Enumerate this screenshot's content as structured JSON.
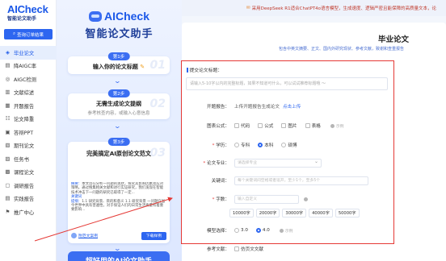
{
  "sidebar": {
    "logo_title": "AICheck",
    "logo_sub": "智能论文助手",
    "query_button": "查询订单结果",
    "items": [
      {
        "label": "毕业论文",
        "icon": "graduation-icon",
        "glyph": "◈",
        "active": true
      },
      {
        "label": "降AIGC率",
        "icon": "reduce-aigc-icon",
        "glyph": "▤",
        "active": false
      },
      {
        "label": "AIGC检测",
        "icon": "detect-icon",
        "glyph": "◎",
        "active": false
      },
      {
        "label": "文献综述",
        "icon": "literature-icon",
        "glyph": "▥",
        "active": false
      },
      {
        "label": "开题报告",
        "icon": "proposal-icon",
        "glyph": "▦",
        "active": false
      },
      {
        "label": "论文降重",
        "icon": "dedup-icon",
        "glyph": "☷",
        "active": false
      },
      {
        "label": "答辩PPT",
        "icon": "ppt-icon",
        "glyph": "▣",
        "active": false
      },
      {
        "label": "期刊论文",
        "icon": "journal-icon",
        "glyph": "▧",
        "active": false
      },
      {
        "label": "任务书",
        "icon": "task-icon",
        "glyph": "▨",
        "active": false
      },
      {
        "label": "课程论文",
        "icon": "course-icon",
        "glyph": "▩",
        "active": false
      },
      {
        "label": "调研报告",
        "icon": "survey-icon",
        "glyph": "▢",
        "active": false
      },
      {
        "label": "实践报告",
        "icon": "practice-icon",
        "glyph": "▤",
        "active": false
      },
      {
        "label": "推广中心",
        "icon": "promo-icon",
        "glyph": "⚑",
        "active": false
      }
    ]
  },
  "promo": {
    "brand": "AICheck",
    "title": "智能论文助手",
    "step1": {
      "badge": "第1步",
      "title": "输入你的论文标题",
      "num": "01"
    },
    "step2": {
      "badge": "第2步",
      "title": "无需生成论文提纲",
      "sub": "参考核查内容，或输入心意信息",
      "num": "02"
    },
    "step3": {
      "badge": "第3步",
      "title": "完美搞定AI原创论文范文",
      "num": "03",
      "abstract_label": "摘要：",
      "abstract": "本文旨在分析一问题的现状，探究其影响因素及应对策略。通过搜集相关文献和进行实证研究，我们发现在智能技术冲击下一问题的研究已取得了一定...",
      "keywords_label": "关键词",
      "outline_label": "提纲：",
      "outline": "1.1 研究背景、目的和意义 1.1 研究背景 一问题在当今世界中具有普遍性，对于保证人们的日常生活质量有着重要影响...",
      "author": "附范文案例",
      "download": "下载样例"
    },
    "bottom": "超好用的AI论文助手"
  },
  "main": {
    "marquee": "采用DeepSeek R1适合ChatPT4o语言模型，生成速度、逻辑严密且能保障的高质量文本，论",
    "form_title": "毕业论文",
    "form_sub": "包含中英文摘要、正文、国内外研究现状、参考文献，致谢和查重报告",
    "topic_label": "提交论文标题：",
    "topic_placeholder": "请输入5-10字以内的完整标题，如果不知道可什么，可以试试推荐标题哦 ～",
    "report_label": "开题报告：",
    "report_text": "上传开题报告生成论文",
    "report_link": "点击上传",
    "chart_label": "图表公式：",
    "chart_options": [
      "代码",
      "公式",
      "图片",
      "表格"
    ],
    "chart_hint": "示例",
    "degree_label": "学历：",
    "degree_options": [
      {
        "label": "专科",
        "on": false
      },
      {
        "label": "本科",
        "on": true
      },
      {
        "label": "硕博",
        "on": false
      }
    ],
    "major_label": "论文专业：",
    "major_placeholder": "请选择专业",
    "keywords_label": "关键词：",
    "keywords_placeholder": "每个关键词间空格或者逗开，至少1个，至多5个",
    "words_label": "字数：",
    "words_placeholder": "输入自定义",
    "word_chips": [
      "10000字",
      "20000字",
      "30000字",
      "40000字",
      "50000字"
    ],
    "model_label": "模型选择：",
    "model_options": [
      {
        "label": "3.0",
        "on": false
      },
      {
        "label": "4.0",
        "on": true
      }
    ],
    "model_hint": "示例",
    "ref_label": "参考文献：",
    "ref_option": "仿页文文献"
  }
}
